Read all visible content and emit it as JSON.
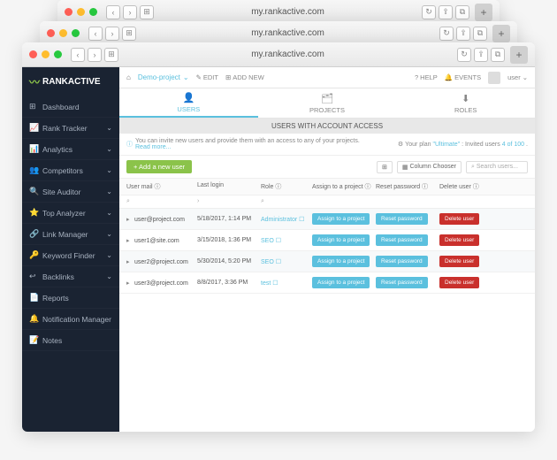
{
  "url": "my.rankactive.com",
  "brand": "RANKACTIVE",
  "sidebar": {
    "items": [
      {
        "icon": "⊞",
        "label": "Dashboard",
        "expand": false
      },
      {
        "icon": "📈",
        "label": "Rank Tracker",
        "expand": true
      },
      {
        "icon": "📊",
        "label": "Analytics",
        "expand": true
      },
      {
        "icon": "👥",
        "label": "Competitors",
        "expand": true
      },
      {
        "icon": "🔍",
        "label": "Site Auditor",
        "expand": true
      },
      {
        "icon": "⭐",
        "label": "Top Analyzer",
        "expand": true
      },
      {
        "icon": "🔗",
        "label": "Link Manager",
        "expand": true
      },
      {
        "icon": "🔑",
        "label": "Keyword Finder",
        "expand": true
      },
      {
        "icon": "↩",
        "label": "Backlinks",
        "expand": true
      },
      {
        "icon": "📄",
        "label": "Reports",
        "expand": false
      },
      {
        "icon": "🔔",
        "label": "Notification Manager",
        "expand": false
      },
      {
        "icon": "📝",
        "label": "Notes",
        "expand": false
      }
    ]
  },
  "topbar": {
    "project": "Demo-project",
    "edit": "EDIT",
    "addnew": "ADD NEW",
    "help": "HELP",
    "events": "EVENTS",
    "user": "user"
  },
  "tabs": [
    {
      "icon": "👤",
      "label": "USERS"
    },
    {
      "icon": "🗂",
      "label": "PROJECTS"
    },
    {
      "icon": "⬇",
      "label": "ROLES"
    }
  ],
  "section_title": "USERS WITH ACCOUNT ACCESS",
  "info_text": "You can invite new users and provide them with an access to any of your projects.",
  "readmore": "Read more...",
  "plan_label": "Your plan ",
  "plan_name": "\"Ultimate\"",
  "plan_suffix": ": Invited users ",
  "plan_count": "4 of 100",
  "plan_dot": ".",
  "add_user": "+ Add a new user",
  "col_chooser": "Column Chooser",
  "search_placeholder": "Search users...",
  "columns": {
    "c1": "User mail",
    "c2": "Last login",
    "c3": "Role",
    "c4": "Assign to a project",
    "c5": "Reset password",
    "c6": "Delete user"
  },
  "filters": {
    "f1": "",
    "f2": "",
    "f3": ""
  },
  "btn_assign": "Assign to a project",
  "btn_reset": "Reset password",
  "btn_delete": "Delete user",
  "rows": [
    {
      "mail": "user@project.com",
      "login": "5/18/2017, 1:14 PM",
      "role": "Administrator"
    },
    {
      "mail": "user1@site.com",
      "login": "3/15/2018, 1:36 PM",
      "role": "SEO"
    },
    {
      "mail": "user2@project.com",
      "login": "5/30/2014, 5:20 PM",
      "role": "SEO"
    },
    {
      "mail": "user3@project.com",
      "login": "8/8/2017, 3:36 PM",
      "role": "test"
    }
  ]
}
